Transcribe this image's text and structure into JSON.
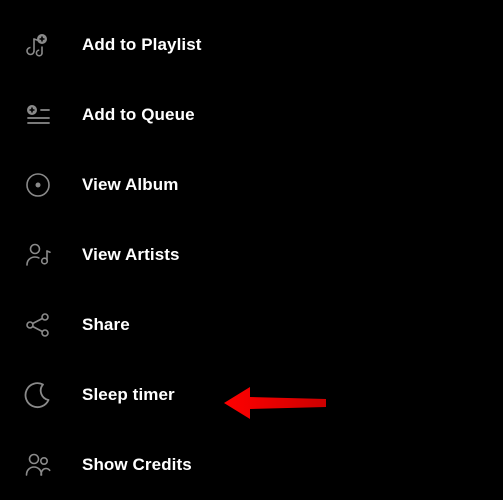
{
  "menu": {
    "items": [
      {
        "label": "Add to Playlist"
      },
      {
        "label": "Add to Queue"
      },
      {
        "label": "View Album"
      },
      {
        "label": "View Artists"
      },
      {
        "label": "Share"
      },
      {
        "label": "Sleep timer"
      },
      {
        "label": "Show Credits"
      }
    ]
  },
  "annotation": {
    "arrow_color": "#ff0000"
  }
}
